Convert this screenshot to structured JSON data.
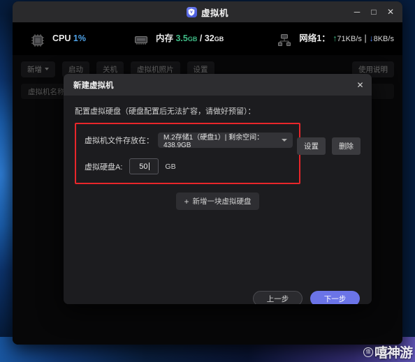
{
  "window": {
    "title": "虚拟机",
    "logo_icon": "shield-v-icon",
    "minimize_label": "─",
    "maximize_label": "□",
    "close_label": "✕"
  },
  "stats": {
    "cpu": {
      "icon": "cpu-chip-icon",
      "label": "CPU",
      "value": "1%",
      "bar_percent": 1
    },
    "memory": {
      "icon": "memory-chip-icon",
      "label": "内存",
      "used": "3.5",
      "used_unit": "GB",
      "separator": "/",
      "total": "32",
      "total_unit": "GB",
      "bar_percent": 11
    },
    "network": {
      "icon": "network-icon",
      "label": "网络1：",
      "up_arrow": "↑",
      "up_value": "71KB/s",
      "divider": "|",
      "down_arrow": "↓",
      "down_value": "8KB/s"
    }
  },
  "toolbar": {
    "add_label": "新增",
    "start_label": "启动",
    "stop_label": "关机",
    "snapshot_label": "虚拟机照片",
    "more_label": "设置",
    "help_label": "使用说明"
  },
  "list_header": {
    "name_column": "虚拟机名称"
  },
  "modal": {
    "title": "新建虚拟机",
    "close_label": "✕",
    "section_note": "配置虚拟硬盘（硬盘配置后无法扩容，请做好预留）：",
    "storage_field": {
      "label": "虚拟机文件存放在：",
      "value": "M.2存储1（硬盘1）| 剩余空间：438.9GB",
      "caret_icon": "chevron-down-icon"
    },
    "disk_field": {
      "label": "虚拟硬盘A:",
      "value": "50",
      "unit": "GB"
    },
    "row_actions": {
      "settings_label": "设置",
      "delete_label": "删除"
    },
    "add_disk_label": "新增一块虚拟硬盘",
    "add_disk_plus": "+",
    "footer": {
      "prev_label": "上一步",
      "next_label": "下一步"
    },
    "highlight_color": "#e8262a",
    "accent_color": "#6b74e8"
  },
  "watermark": {
    "badge": "值",
    "text": "嘻神游"
  }
}
